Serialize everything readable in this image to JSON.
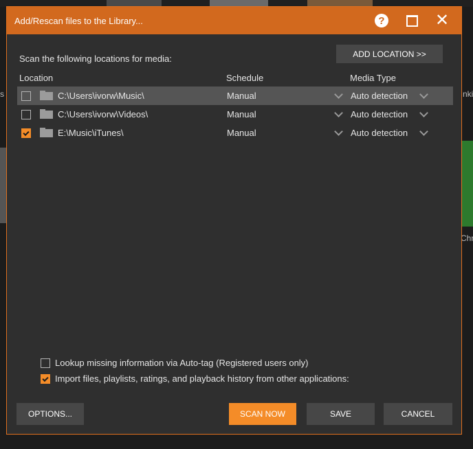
{
  "background": {
    "right_text_1": "nki",
    "right_text_2": "Chr",
    "left_text": "s"
  },
  "dialog": {
    "title": "Add/Rescan files to the Library...",
    "help_glyph": "?",
    "scan_label": "Scan the following locations for media:",
    "add_location_label": "ADD LOCATION >>",
    "columns": {
      "location": "Location",
      "schedule": "Schedule",
      "media_type": "Media Type"
    },
    "rows": [
      {
        "checked": false,
        "location": "C:\\Users\\ivorw\\Music\\",
        "schedule": "Manual",
        "media_type": "Auto detection"
      },
      {
        "checked": false,
        "location": "C:\\Users\\ivorw\\Videos\\",
        "schedule": "Manual",
        "media_type": "Auto detection"
      },
      {
        "checked": true,
        "location": "E:\\Music\\iTunes\\",
        "schedule": "Manual",
        "media_type": "Auto detection"
      }
    ],
    "options": {
      "autotag": {
        "checked": false,
        "label": "Lookup missing information via Auto-tag (Registered users only)"
      },
      "import": {
        "checked": true,
        "label": "Import files, playlists, ratings, and playback history from other applications:"
      }
    },
    "buttons": {
      "options": "OPTIONS...",
      "scan_now": "SCAN NOW",
      "save": "SAVE",
      "cancel": "CANCEL"
    }
  },
  "colors": {
    "titlebar": "#d2691e",
    "accent": "#f48c28",
    "dialog_bg": "#2f2f2f",
    "selected_row": "#555555"
  }
}
